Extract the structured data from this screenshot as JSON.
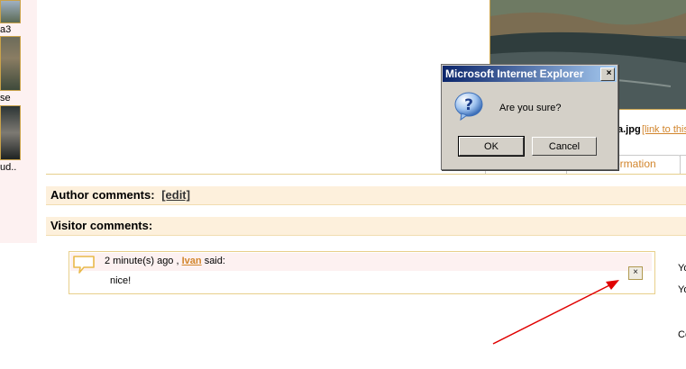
{
  "sidebar": {
    "items": [
      {
        "label": "a3"
      },
      {
        "label": "se"
      },
      {
        "label": "ud.."
      }
    ]
  },
  "photo": {
    "filename": "a.jpg",
    "link_text": "[link to this"
  },
  "tabs": {
    "second_label": "ormation"
  },
  "author_comments": {
    "title": "Author comments:",
    "edit": "[edit]"
  },
  "visitor_comments": {
    "title": "Visitor comments:",
    "comments": [
      {
        "time": "2 minute(s) ago ,",
        "user": "Ivan",
        "said": "said:",
        "text": "nice!"
      }
    ]
  },
  "right_edge": [
    "Yo",
    "Yo",
    "Co"
  ],
  "dialog": {
    "title": "Microsoft Internet Explorer",
    "message": "Are you sure?",
    "ok": "OK",
    "cancel": "Cancel",
    "close": "×"
  },
  "colors": {
    "accent": "#d2852c",
    "header_bg": "#fdf0dc",
    "arrow": "#e00000"
  }
}
